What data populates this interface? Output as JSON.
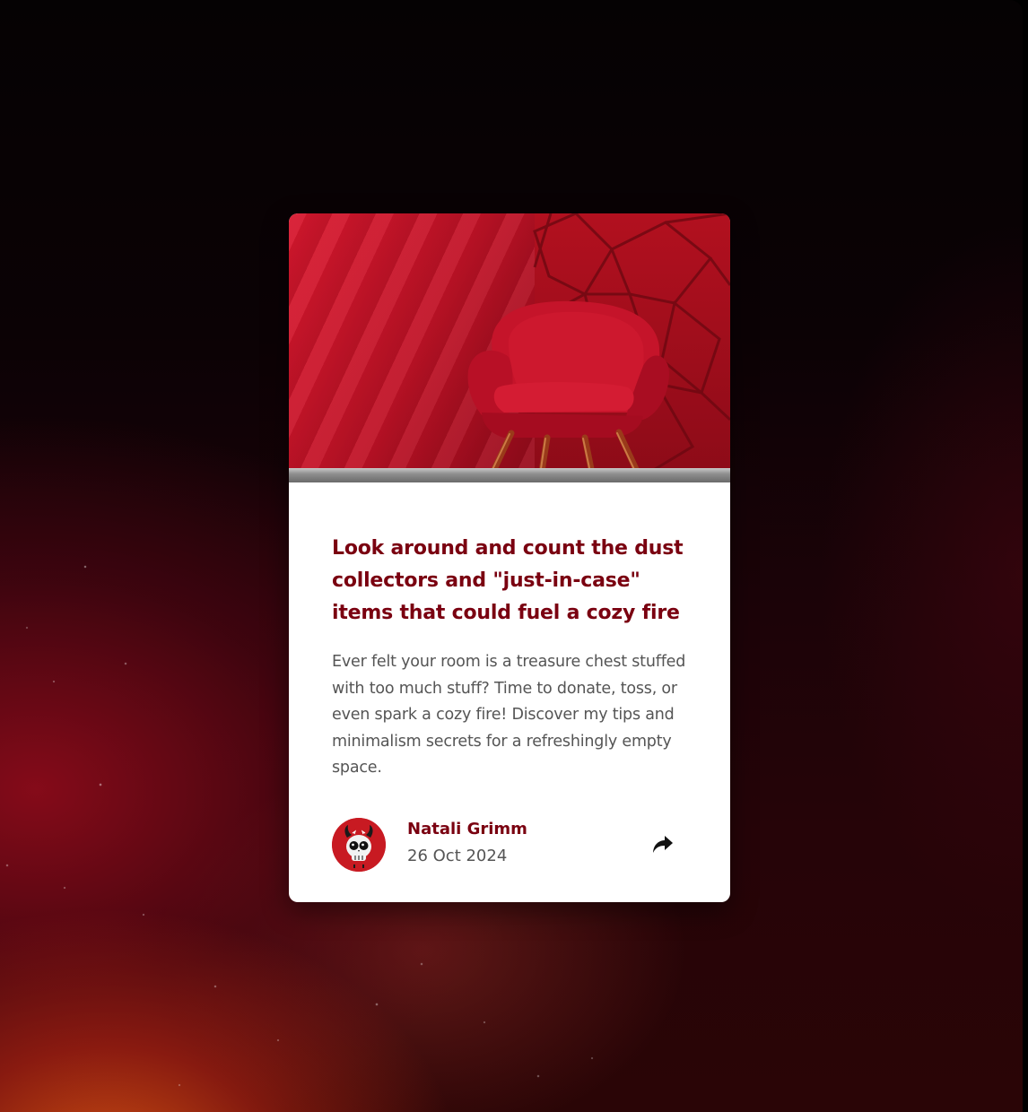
{
  "post": {
    "title": "Look around and count the dust collectors and \"just-in-case\" items that could fuel a cozy fire",
    "description": "Ever felt your room is a treasure chest stuffed with too much stuff? Time to donate, toss, or even spark a cozy fire! Discover my tips and minimalism secrets for a refreshingly empty space.",
    "image_icon": "red-armchair-image"
  },
  "author": {
    "name": "Natali Grimm",
    "date": "26 Oct 2024",
    "avatar_icon": "devil-skull-avatar"
  },
  "actions": {
    "share_icon": "share-icon"
  },
  "colors": {
    "title": "#7a0010",
    "text": "#555555",
    "card_background": "#ffffff",
    "accent": "#c81a22"
  }
}
